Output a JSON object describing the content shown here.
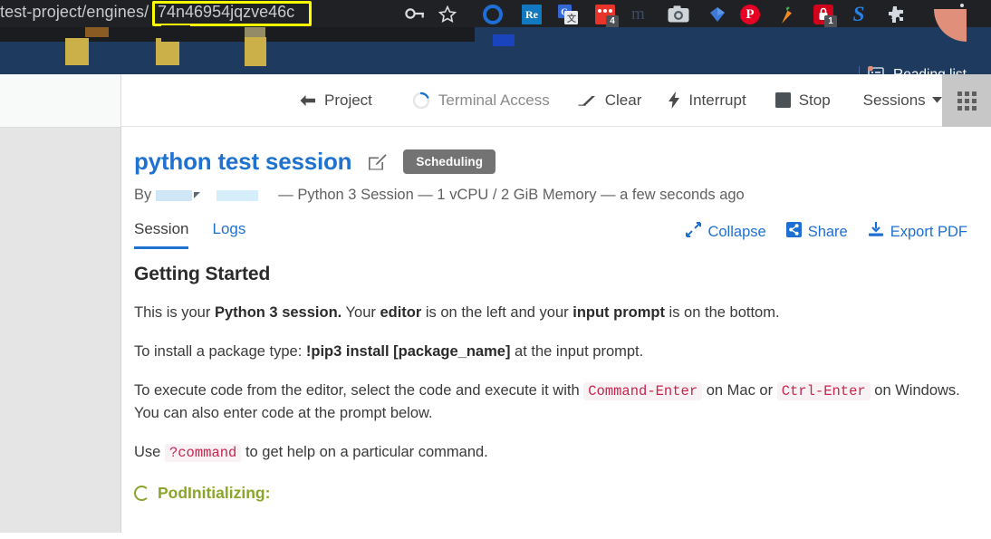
{
  "browser": {
    "url_prefix": "test-project/engines/",
    "url_highlighted": "74n46954jqzve46c",
    "icons": {
      "key": "key-icon",
      "star": "bookmark-star-icon",
      "menu": "chrome-menu-icon"
    },
    "extensions": [
      {
        "name": "ring-extension",
        "label": ""
      },
      {
        "name": "re-extension",
        "label": "Re"
      },
      {
        "name": "google-translate-extension",
        "label": ""
      },
      {
        "name": "red-notes-extension",
        "label": "",
        "badge": "4"
      },
      {
        "name": "m-extension",
        "label": "m"
      },
      {
        "name": "camera-extension",
        "label": ""
      },
      {
        "name": "diamond-extension",
        "label": ""
      },
      {
        "name": "pinterest-extension",
        "label": "P"
      },
      {
        "name": "carrot-extension",
        "label": ""
      },
      {
        "name": "password-lock-extension",
        "label": "",
        "badge": "1"
      },
      {
        "name": "skype-extension",
        "label": "S"
      },
      {
        "name": "puzzle-extensions-icon",
        "label": ""
      }
    ],
    "reading_list_label": "Reading list"
  },
  "toolbar": {
    "items": [
      {
        "name": "project-button",
        "label": "Project",
        "icon": "arrow-left-icon",
        "muted": false
      },
      {
        "name": "terminal-access-button",
        "label": "Terminal Access",
        "icon": "spinner-icon",
        "muted": true
      },
      {
        "name": "clear-button",
        "label": "Clear",
        "icon": "eraser-icon",
        "muted": false
      },
      {
        "name": "interrupt-button",
        "label": "Interrupt",
        "icon": "bolt-icon",
        "muted": false
      },
      {
        "name": "stop-button",
        "label": "Stop",
        "icon": "stop-square-icon",
        "muted": false
      },
      {
        "name": "sessions-dropdown",
        "label": "Sessions",
        "icon": "chevron-down-icon",
        "muted": false
      }
    ],
    "apps_grid_name": "apps-grid-icon"
  },
  "session": {
    "title": "python test session",
    "status_badge": "Scheduling",
    "by_prefix": "By",
    "meta": "— Python 3 Session — 1 vCPU / 2 GiB Memory — a few seconds ago"
  },
  "tabs": [
    {
      "name": "tab-session",
      "label": "Session",
      "active": true
    },
    {
      "name": "tab-logs",
      "label": "Logs",
      "active": false
    }
  ],
  "actions": [
    {
      "name": "collapse-action",
      "label": "Collapse",
      "icon": "collapse-arrows-icon"
    },
    {
      "name": "share-action",
      "label": "Share",
      "icon": "share-icon"
    },
    {
      "name": "export-pdf-action",
      "label": "Export PDF",
      "icon": "download-icon"
    }
  ],
  "getting_started": {
    "heading": "Getting Started",
    "p1_a": "This is your ",
    "p1_b": "Python 3 session.",
    "p1_c": " Your ",
    "p1_d": "editor",
    "p1_e": " is on the left and your ",
    "p1_f": "input prompt",
    "p1_g": " is on the bottom.",
    "p2_a": "To install a package type: ",
    "p2_b": "!pip3 install [package_name]",
    "p2_c": " at the input prompt.",
    "p3_a": "To execute code from the editor, select the code and execute it with ",
    "p3_code1": "Command-Enter",
    "p3_b": " on Mac or ",
    "p3_code2": "Ctrl-Enter",
    "p3_c": " on Windows. You can also enter code at the prompt below.",
    "p4_a": "Use ",
    "p4_code": "?command",
    "p4_b": " to get help on a particular command."
  },
  "status": {
    "text": "PodInitializing:",
    "color": "#8aa52a"
  },
  "colors": {
    "accent_blue": "#1f72d0",
    "chrome_dark": "#202124",
    "bookmark_band": "#1e3a5f",
    "badge_gray": "#737373",
    "code_pink": "#c7254e"
  }
}
